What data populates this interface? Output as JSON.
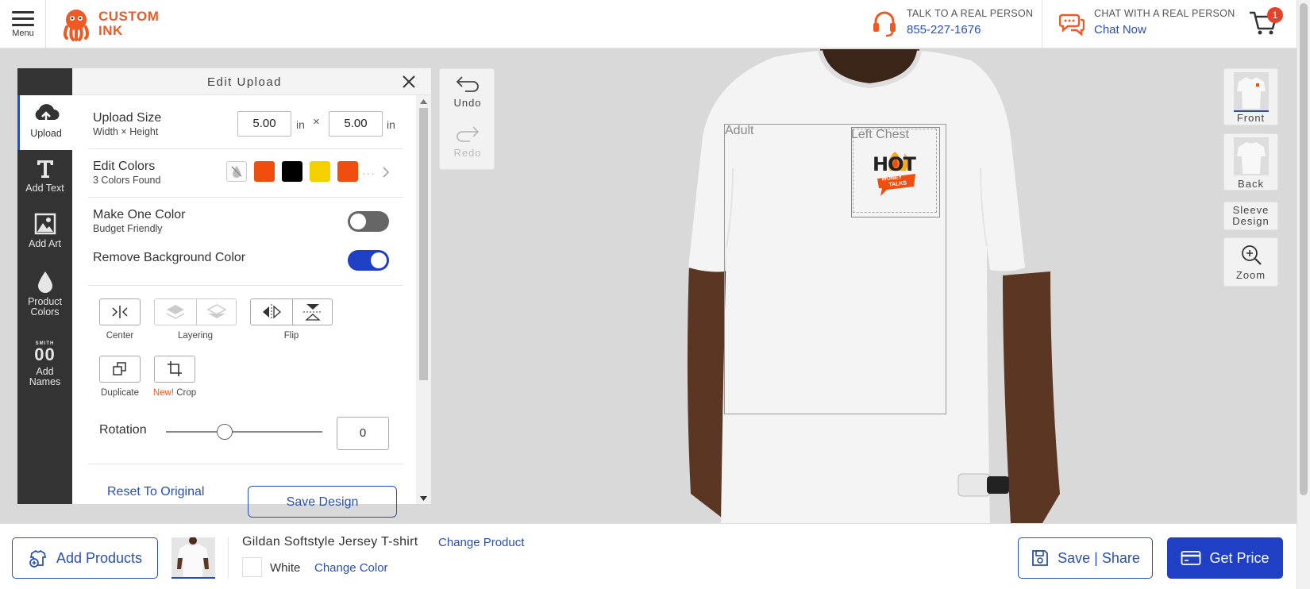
{
  "header": {
    "menu_label": "Menu",
    "logo_line1": "CUSTOM",
    "logo_line2": "INK",
    "phone_caption": "TALK TO A REAL PERSON",
    "phone_number": "855-227-1676",
    "chat_caption": "CHAT WITH A REAL PERSON",
    "chat_link": "Chat Now",
    "cart_count": "1"
  },
  "rail": {
    "items": [
      {
        "label": "Upload",
        "icon": "cloud-upload-icon"
      },
      {
        "label": "Add Text",
        "icon": "text-icon"
      },
      {
        "label": "Add Art",
        "icon": "image-icon"
      },
      {
        "label_line1": "Product",
        "label_line2": "Colors",
        "icon": "drop-icon"
      },
      {
        "label_line1": "Add",
        "label_line2": "Names",
        "icon": "names-icon",
        "icon_text": "SMITH",
        "icon_num": "00"
      }
    ]
  },
  "panel": {
    "title": "Edit Upload",
    "upload_size_label": "Upload Size",
    "upload_size_sub": "Width × Height",
    "width_value": "5.00",
    "height_value": "5.00",
    "unit": "in",
    "times": "×",
    "edit_colors_label": "Edit Colors",
    "edit_colors_sub": "3 Colors Found",
    "color_swatches": [
      "#f04e0e",
      "#000000",
      "#f5d000",
      "#f04e0e"
    ],
    "more_dots": "...",
    "one_color_label": "Make One Color",
    "one_color_sub": "Budget Friendly",
    "one_color_on": false,
    "remove_bg_label": "Remove Background Color",
    "remove_bg_on": true,
    "tools": {
      "center": "Center",
      "layering": "Layering",
      "flip": "Flip",
      "duplicate": "Duplicate",
      "new_badge": "New!",
      "crop": "Crop"
    },
    "rotation_label": "Rotation",
    "rotation_value": "0",
    "rotation_level": 0.5,
    "reset_label": "Reset To Original",
    "save_design_label": "Save Design"
  },
  "undo_redo": {
    "undo": "Undo",
    "redo": "Redo"
  },
  "canvas": {
    "area_adult": "Adult",
    "area_left_chest": "Left Chest",
    "design_text_hot": "HOT",
    "design_text_money": "MONEY",
    "design_text_talks": "TALKS"
  },
  "views": {
    "front": "Front",
    "back": "Back",
    "sleeve_line1": "Sleeve",
    "sleeve_line2": "Design",
    "zoom": "Zoom"
  },
  "bottom": {
    "add_products": "Add Products",
    "product_name": "Gildan Softstyle Jersey T-shirt",
    "change_product": "Change Product",
    "color_name": "White",
    "change_color": "Change Color",
    "save_share": "Save | Share",
    "get_price": "Get Price"
  },
  "colors": {
    "brand_orange": "#ee5a24",
    "link_blue": "#2a4fb0",
    "primary_blue": "#1f3fc4",
    "rail_dark": "#333333"
  }
}
